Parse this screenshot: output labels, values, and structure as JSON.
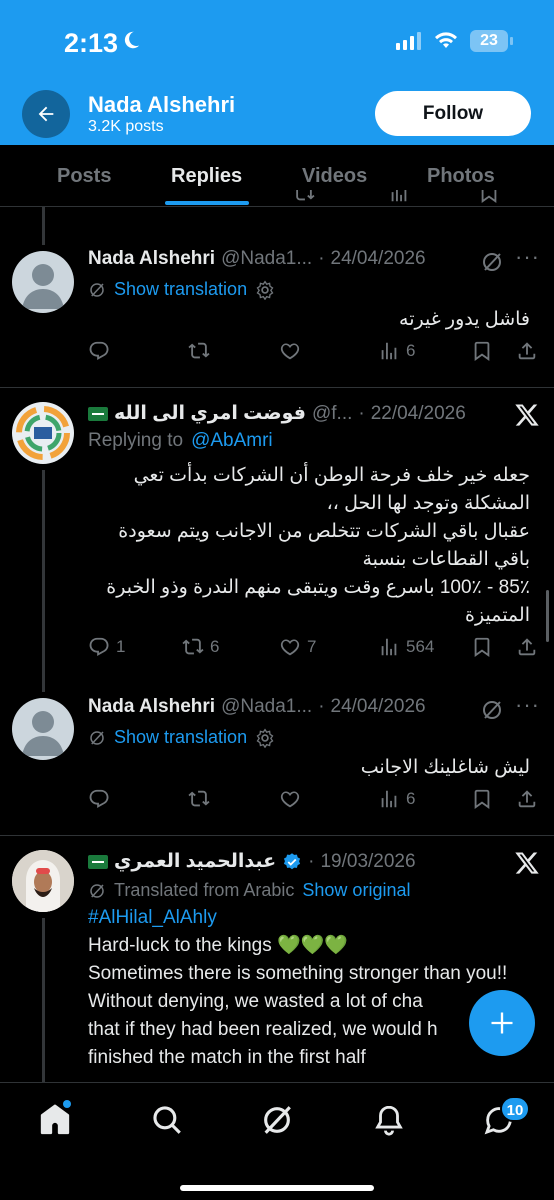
{
  "status_bar": {
    "time": "2:13",
    "battery": "23"
  },
  "header": {
    "name": "Nada Alshehri",
    "posts": "3.2K posts",
    "follow_label": "Follow"
  },
  "tabs": [
    {
      "label": "Posts",
      "active": false
    },
    {
      "label": "Replies",
      "active": true
    },
    {
      "label": "Videos",
      "active": false
    },
    {
      "label": "Photos",
      "active": false
    }
  ],
  "tweets": [
    {
      "name": "Nada Alshehri",
      "handle": "@Nada1...",
      "date": "24/04/2026",
      "show_translation": "Show translation",
      "text": "فاشل يدور غيرته",
      "replies": "",
      "reposts": "",
      "likes": "",
      "views": "6"
    },
    {
      "name": "فوضت امري الى الله",
      "handle": "@f...",
      "date": "22/04/2026",
      "replying_label": "Replying to",
      "replying_to": "@AbAmri",
      "text": "جعله خير خلف فرحة الوطن أن الشركات بدأت تعي المشكلة وتوجد لها الحل ،،\nعقبال باقي الشركات تتخلص من الاجانب ويتم سعودة باقي القطاعات بنسبة\n85٪ - 100٪  باسرع وقت ويتبقى منهم الندرة وذو الخبرة المتميزة",
      "replies": "1",
      "reposts": "6",
      "likes": "7",
      "views": "564"
    },
    {
      "name": "Nada Alshehri",
      "handle": "@Nada1...",
      "date": "24/04/2026",
      "show_translation": "Show translation",
      "text": "ليش شاغلينك الاجانب",
      "replies": "",
      "reposts": "",
      "likes": "",
      "views": "6"
    },
    {
      "name": "عبدالحميد العمري",
      "date": "19/03/2026",
      "translated_label": "Translated from Arabic",
      "show_original": "Show original",
      "hashtag": "#AlHilal_AlAhly",
      "line1": "Hard-luck to the kings 💚💚💚",
      "line2": "Sometimes there is something stronger than you!!",
      "line3": "Without denying, we wasted a lot of cha",
      "line4": "that if they had been realized, we would h",
      "line5": "finished the match in the first half"
    }
  ],
  "nav": {
    "messages_badge": "10"
  },
  "colors": {
    "accent": "#1d9bf0",
    "background": "#000000",
    "muted": "#71767b"
  }
}
